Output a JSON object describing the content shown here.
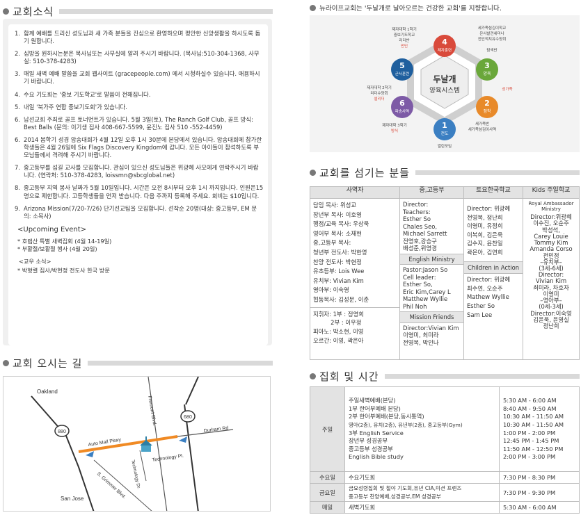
{
  "sections": {
    "news": "교회소식",
    "directions": "교회 오시는 길",
    "staff": "교회를 섬기는 분들",
    "schedule": "집회 및 시간"
  },
  "vision": "뉴라이프교회는 '두날개로 날아오르는 건강한 교회'를 지향합니다.",
  "news": {
    "items": [
      {
        "num": "1.",
        "text": "함께 예배를 드리신 성도님과 새 가족 분들을 진심으로 환영하오며 평안한 신앙생활을 하시도록 돕기 원합니다."
      },
      {
        "num": "2.",
        "text": "심방을 원하시는분은 목사님또는 사무실에 알려 주시기 바랍니다. (목사님:510-304-1368, 사무실: 510-378-4283)"
      },
      {
        "num": "3.",
        "text": "매일 새벽 예배 말씀을 교회 웹사이트 (gracepeople.com) 에서 시청하실수 있습니다. 애용하시기 바랍니다."
      },
      {
        "num": "4.",
        "text": "수요 기도회는 '중보 기도학교'로 말씀이 전해집니다."
      },
      {
        "num": "5.",
        "text": "내일 '북가주 연합 중보기도회'가 있습니다."
      },
      {
        "num": "6.",
        "text": "남선교회 주최로 골프 토너먼트가 있습니다. 5월 3일(토), The Ranch Golf Club, 골프 방식: Best Balls (문의: 이기생 집사 408-667-5599, 윤진노 집사 510 -552-4459)"
      },
      {
        "num": "6.",
        "text": "2014 봄학기 성경 암송대회가 4월 12일 오후 1시 30분에 본당에서 있습니다. 암송대회에 참가한 학생들은 4월 26일에 Six Flags Discovery Kingdom에 갑니다. 모든 아이들이 참석하도록 부모님들께서 격려해 주시기 바랍니다."
      },
      {
        "num": "7.",
        "text": "중고등부를 섬길 교사를 모집합니다. 관심이 있으신 성도님들은 위광혜 사모에게 연락주시기 바랍니다. (연락처: 510-378-4283, loissmn@sbcglobal.net)"
      },
      {
        "num": "8.",
        "text": "중고등부 지역 봉사 날짜가 5월 10일입니다. 시간은 오전 8시부터 오후 1시 까지입니다. 인원은15명으로 제한합니다. 고등학생들을 먼저 받습니다. 다음 주까지 등록해 주세요. 회비는 $10입니다."
      },
      {
        "num": "9.",
        "text": "Arizona Mission(7/20-7/26) 단기선교팀을 모집합니다. 선착순 20명(대상: 중고등부, EM 문의: 소목사)"
      }
    ],
    "upcoming_title": "<Upcoming Event>",
    "events": [
      "* 호렙산 특별 새벽집회 (4월 14-19일)",
      "* 부활절/보활절 행사 (4월 20일)"
    ],
    "sub_title": "<교우 소식>",
    "sub_items": [
      "* 박형렬 집사/박현정 전도사 한국 방문"
    ]
  },
  "map": {
    "labels": [
      "Oakland",
      "San Jose",
      "Fremont Blvd.",
      "Auto Mall Pkwy",
      "Durham Rd",
      "Technology Dr.",
      "Technology Pl.",
      "S. Grimmer Blvd."
    ],
    "shields": [
      "880",
      "680"
    ]
  },
  "diagram": {
    "center": [
      "두날개",
      "양육시스템"
    ],
    "nodes": [
      {
        "num": "1",
        "name": "전도",
        "color": "#3b7fc2"
      },
      {
        "num": "2",
        "name": "정착",
        "color": "#e88a2a"
      },
      {
        "num": "3",
        "name": "양육",
        "color": "#6aa73a"
      },
      {
        "num": "4",
        "name": "제자훈련",
        "color": "#d94a3b"
      },
      {
        "num": "5",
        "name": "군사훈련",
        "color": "#1f5f9e"
      },
      {
        "num": "6",
        "name": "파송사역",
        "color": "#7d5aa6"
      }
    ],
    "notes": [
      {
        "lines": [
          "제자대학 1학기",
          "중보기도학교",
          "리더반"
        ],
        "accent": "만민"
      },
      {
        "lines": [
          "세가족섬김이학교",
          "은사발견세미나",
          "전인적치유수양회"
        ],
        "accent": "탐색반"
      },
      {
        "lines": [
          "제자대학 2학기",
          "리더수양회"
        ],
        "accent": "셀리더"
      },
      {
        "lines": [],
        "accent": "성가족"
      },
      {
        "lines": [
          "제자대학 3학기"
        ],
        "accent": "방식"
      },
      {
        "lines": [
          "새가족반",
          "세가족섬김이사역"
        ],
        "accent": ""
      }
    ],
    "bottom": "열린모임"
  },
  "staff": {
    "headers": [
      "사역자",
      "중,고등부",
      "토요한국학교",
      "Kids 주일학교"
    ],
    "col1a": [
      "담임 목사: 위성교",
      "장년부 목사: 이호영",
      "행정/교육 목사: 우상욱",
      "영어부 목사: 소재현",
      "중,고등부 목사:",
      "청년부 전도사: 박한영",
      "찬양 전도사: 박현정",
      "유초등부: Lois Wee",
      "유치부: Vivian Kim",
      "영아부: 이숙영",
      "협동목사: 김성문, 이춘"
    ],
    "col1b": [
      "지휘자: 1부 : 정영희",
      "　　　2부 : 이우정",
      "피아노: 박소현, 이영",
      "오르간: 이영, 곽은아"
    ],
    "col2a": [
      "Director:",
      "Teachers:",
      "Esther So",
      "Chales Seo,",
      "Michael Sarrett",
      "전영호,강승구",
      "배성준,위영경"
    ],
    "col2_sub1": "English Ministry",
    "col2b": [
      "Pastor:Jason So",
      "Cell leader:",
      "Esther So,",
      "Eric Kim,Carey L",
      "Matthew Wyllie",
      "Phil Noh"
    ],
    "col2_sub2": "Mission Friends",
    "col2c": [
      "Director:Vivian Kim",
      "이영미, 최미라",
      "전영복, 박인나"
    ],
    "col3a": [
      "Director: 위광혜",
      "전영복, 정난희",
      "이영미, 유정희",
      "이복희, 김은욱",
      "김수지, 윤찬일",
      "곽은아, 김연희"
    ],
    "col3_sub": "Children in Action",
    "col3b": [
      "Director: 위광혜",
      "최수연, 오순주",
      "Mathew Wyllie",
      "Esther So",
      "Sam Lee"
    ],
    "col4a": [
      "Royal Ambassador",
      "Ministry"
    ],
    "col4b": [
      "Director:위광혜",
      "이수진, 오순주",
      "박성석,",
      "Carey Louie",
      "Tommy Kim",
      "Amanda Corso",
      "전민정",
      "–유치부–",
      "(3세-6세)",
      "Director:",
      "Vivian Kim",
      "최미라, 차호자",
      "이영미",
      "–영아부–",
      "(0세-3세)",
      "Director:이숙영",
      "김윤욱, 윤영실",
      "정난희"
    ]
  },
  "schedule": [
    {
      "day": "주일",
      "items": [
        {
          "name": "주일새벽예배(본당)",
          "time": "5:30 AM - 6:00 AM"
        },
        {
          "name": "1부 한어부예배 본당)",
          "time": "8:40 AM - 9:50 AM"
        },
        {
          "name": "2부 한어부예배(본당,동시통역)",
          "time": "10:30 AM - 11:50 AM"
        },
        {
          "name": "영아(2층), 유치(2층), 유년부(2층), 중고등부(Gym)",
          "time": "10:30 AM - 11:50 AM"
        },
        {
          "name": "3부 English Service",
          "time": "1:00 PM - 2:00 PM"
        },
        {
          "name": "장년부 성경공부",
          "time": "12:45 PM - 1:45 PM"
        },
        {
          "name": "중고등부 성경공부",
          "time": "11:50 AM - 12:50 PM"
        },
        {
          "name": "English Bible study",
          "time": "2:00 PM - 3:00 PM"
        }
      ]
    },
    {
      "day": "수요일",
      "items": [
        {
          "name": "수요기도회",
          "time": "7:30 PM - 8:30 PM"
        }
      ]
    },
    {
      "day": "금요일",
      "items": [
        {
          "name": "금요성령집회 및 철야 기도회,유년 CIA,미션 프렌즈",
          "time": "7:30 PM - 9:30 PM"
        },
        {
          "name": "중고등부 찬양예배,성경공부,EM 성경공부",
          "time": ""
        }
      ]
    },
    {
      "day": "매일",
      "items": [
        {
          "name": "새벽기도회",
          "time": "5:30 AM - 6:00 AM"
        }
      ]
    }
  ]
}
